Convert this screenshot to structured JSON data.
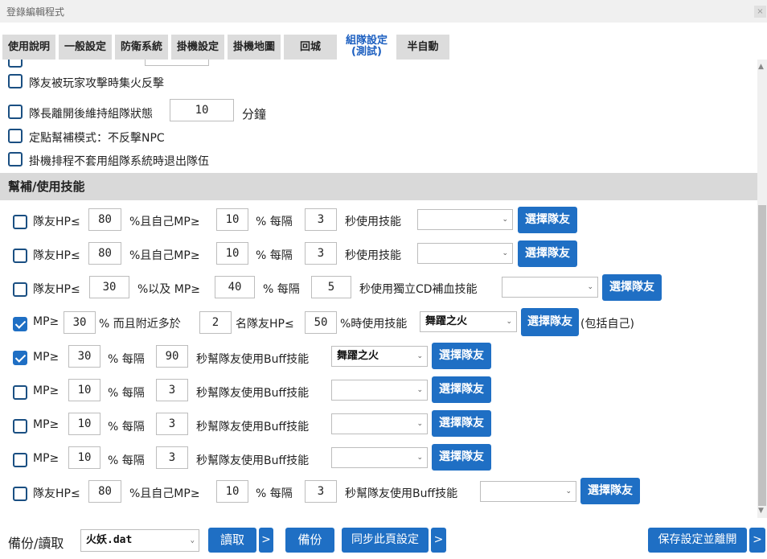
{
  "window": {
    "title": "登錄編輯程式",
    "close": "×"
  },
  "tabs": [
    "使用說明",
    "一般設定",
    "防衛系統",
    "掛機設定",
    "掛機地圖",
    "回城",
    "組隊設定\n(測試)",
    "半自動"
  ],
  "options": {
    "opt1": "隊友被玩家攻擊時集火反擊",
    "opt2_label": "隊長離開後維持組隊狀態",
    "opt2_value": "10",
    "opt2_unit": "分鐘",
    "opt3": "定點幫補模式：不反擊NPC",
    "opt4": "掛機排程不套用組隊系統時退出隊伍"
  },
  "section_title": "幫補/使用技能",
  "rows": {
    "r1": {
      "a": "隊友HP≤",
      "v1": "80",
      "b": "%且自己MP≥",
      "v2": "10",
      "c": "% 每隔",
      "v3": "3",
      "d": "秒使用技能",
      "btn": "選擇隊友"
    },
    "r2": {
      "a": "隊友HP≤",
      "v1": "80",
      "b": "%且自己MP≥",
      "v2": "10",
      "c": "% 每隔",
      "v3": "3",
      "d": "秒使用技能",
      "btn": "選擇隊友"
    },
    "r3": {
      "a": "隊友HP≤",
      "v1": "30",
      "b": "%以及 MP≥",
      "v2": "40",
      "c": "% 每隔",
      "v3": "5",
      "d": "秒使用獨立CD補血技能",
      "btn": "選擇隊友"
    },
    "r4": {
      "a": "MP≥",
      "v1": "30",
      "b": "% 而且附近多於",
      "v2": "2",
      "c": "名隊友HP≤",
      "v3": "50",
      "d": "%時使用技能",
      "skill": "舞躍之火",
      "btn": "選擇隊友",
      "note": "(包括自己)"
    },
    "r5": {
      "a": "MP≥",
      "v1": "30",
      "c": "% 每隔",
      "v3": "90",
      "d": "秒幫隊友使用Buff技能",
      "skill": "舞躍之火",
      "btn": "選擇隊友"
    },
    "r6": {
      "a": "MP≥",
      "v1": "10",
      "c": "% 每隔",
      "v3": "3",
      "d": "秒幫隊友使用Buff技能",
      "btn": "選擇隊友"
    },
    "r7": {
      "a": "MP≥",
      "v1": "10",
      "c": "% 每隔",
      "v3": "3",
      "d": "秒幫隊友使用Buff技能",
      "btn": "選擇隊友"
    },
    "r8": {
      "a": "MP≥",
      "v1": "10",
      "c": "% 每隔",
      "v3": "3",
      "d": "秒幫隊友使用Buff技能",
      "btn": "選擇隊友"
    },
    "r9": {
      "a": "隊友HP≤",
      "v1": "80",
      "b": "%且自己MP≥",
      "v2": "10",
      "c": "% 每隔",
      "v3": "3",
      "d": "秒幫隊友使用Buff技能",
      "btn": "選擇隊友"
    }
  },
  "bottom": {
    "backup_label": "備份/讀取",
    "file": "火妖.dat",
    "read": "讀取",
    "more": ">",
    "backup": "備份",
    "sync": "同步此頁設定",
    "save": "保存設定並離開"
  },
  "colors": {
    "accent": "#1f6fc4",
    "section_bg": "#d9d9d9",
    "tab_bg": "#dcdcdc"
  }
}
